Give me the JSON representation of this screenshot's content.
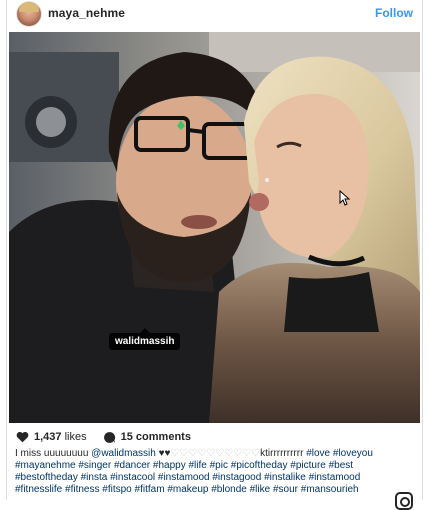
{
  "post": {
    "username": "maya_nehme",
    "follow_label": "Follow",
    "photo_tag": "walidmassih",
    "likes_count": "1,437",
    "likes_label": "likes",
    "comments_count": "15",
    "comments_label": "comments"
  },
  "caption": {
    "line1_start": "I miss uuuuuuuu ",
    "mention": "@walidmassih",
    "hearts": " ♥♥",
    "faint_run": "♡♡♡♡♡♡♡♡♡♡",
    "line1_rest": "ktirrrrrrrrrr ",
    "line1_tags": [
      "#love",
      "#loveyou"
    ],
    "line2_tags": [
      "#mayanehme",
      "#singer",
      "#dancer",
      "#happy",
      "#life",
      "#pic",
      "#picoftheday",
      "#picture",
      "#best"
    ],
    "line3_tags": [
      "#bestoftheday",
      "#insta",
      "#instacool",
      "#instamood",
      "#instagood",
      "#instalike",
      "#instamood"
    ],
    "line4_tags": [
      "#fitnesslife",
      "#fitness",
      "#fitspo",
      "#fitfam",
      "#makeup",
      "#blonde",
      "#like",
      "#sour",
      "#mansourieh"
    ]
  },
  "icons": {
    "heart": "heart-icon",
    "comment": "comment-bubble-icon",
    "user_tag": "user-tag-icon",
    "instagram": "instagram-logo-icon"
  },
  "colors": {
    "link_blue": "#3897f0",
    "hashtag_navy": "#003569",
    "text": "#262626"
  }
}
